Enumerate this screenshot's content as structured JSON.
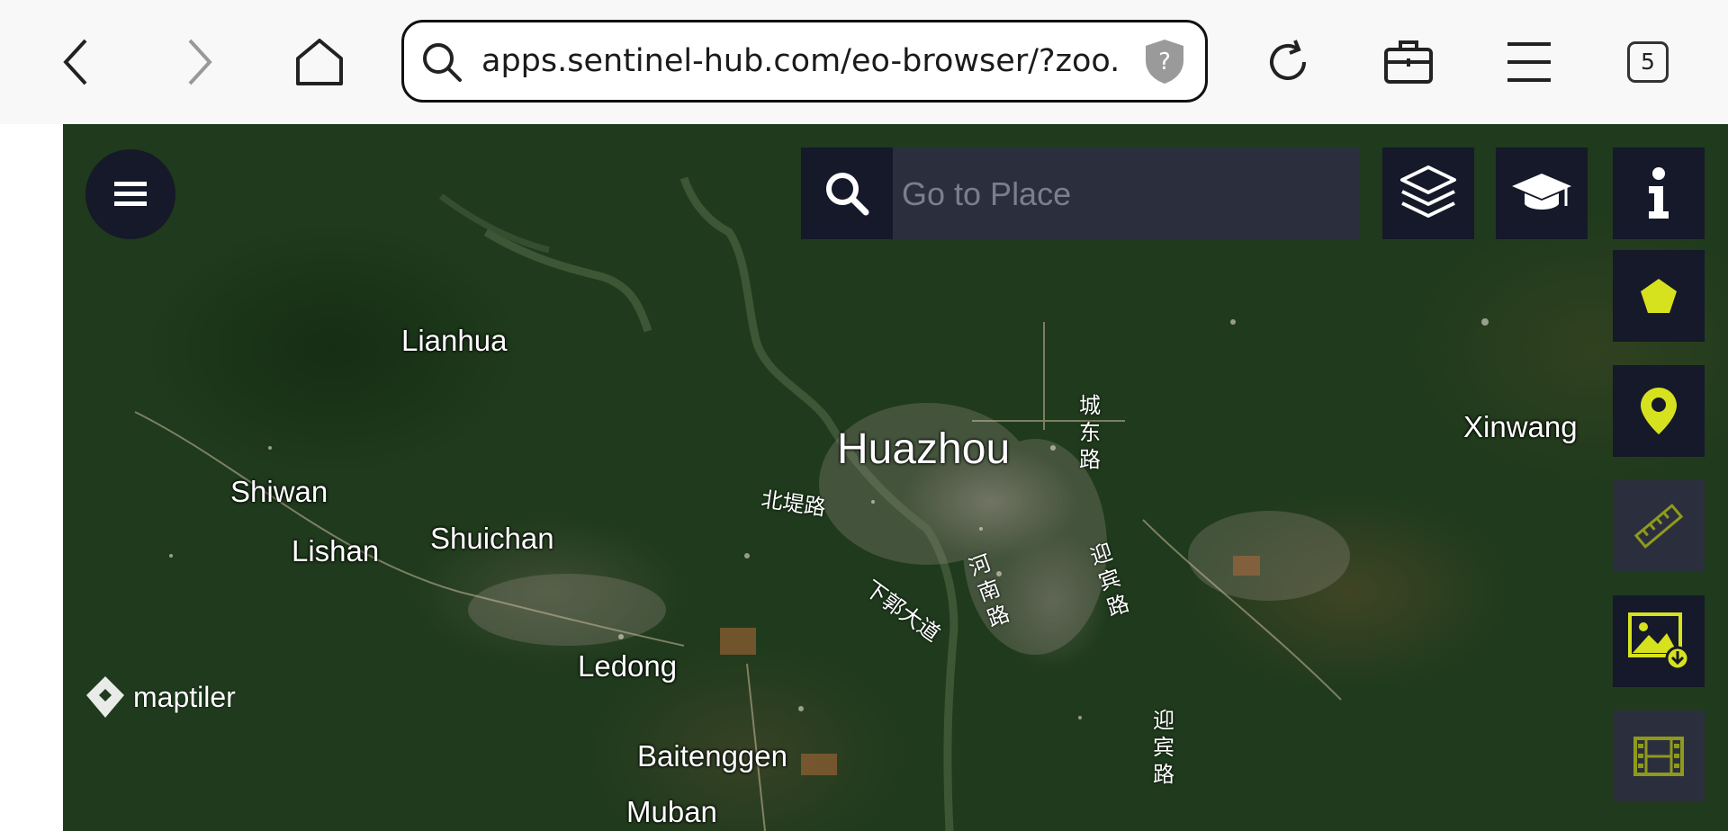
{
  "browser": {
    "url": "apps.sentinel-hub.com/eo-browser/?zoo...",
    "tab_count": "5"
  },
  "map": {
    "search_placeholder": "Go to Place",
    "attribution": "maptiler",
    "places": {
      "huazhou": "Huazhou",
      "lianhua": "Lianhua",
      "shiwan": "Shiwan",
      "lishan": "Lishan",
      "shuichan": "Shuichan",
      "ledong": "Ledong",
      "baitenggen": "Baitenggen",
      "muban": "Muban",
      "xinwang": "Xinwang"
    },
    "roads": {
      "chengdong": "城东路",
      "beiti": "北堤路",
      "yingbin1": "迎宾路",
      "yingbin2": "迎宾路",
      "xiaguo": "下郭大道",
      "henan": "河南路"
    }
  },
  "colors": {
    "panel": "#15192a",
    "accent": "#d7e21f",
    "accent_dim": "#8f9a1c"
  }
}
